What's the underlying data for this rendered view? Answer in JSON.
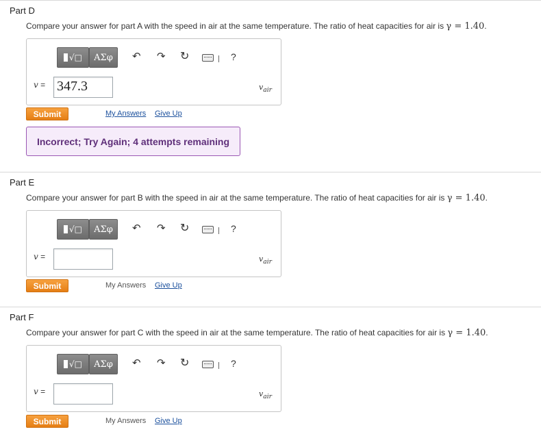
{
  "math": {
    "gamma_expr": "γ = 1.40",
    "variable": "v",
    "equals": "=",
    "unit": "v",
    "unit_sub": "air"
  },
  "toolbar": {
    "templates_glyph": "√□",
    "greek_label": "ΑΣφ",
    "undo_icon": "↶",
    "redo_icon": "↷",
    "reset_icon": "↻",
    "help_label": "?"
  },
  "parts": [
    {
      "title": "Part D",
      "question": "Compare your answer for part A with the speed in air at the same temperature. The ratio of heat capacities for air is ",
      "answer_value": "347.3",
      "submit_label": "Submit",
      "my_answers_label": "My Answers",
      "give_up_label": "Give Up",
      "feedback": "Incorrect; Try Again; 4 attempts remaining"
    },
    {
      "title": "Part E",
      "question": "Compare your answer for part B with the speed in air at the same temperature. The ratio of heat capacities for air is ",
      "answer_value": "",
      "submit_label": "Submit",
      "my_answers_label": "My Answers",
      "give_up_label": "Give Up"
    },
    {
      "title": "Part F",
      "question": "Compare your answer for part C with the speed in air at the same temperature. The ratio of heat capacities for air is ",
      "answer_value": "",
      "submit_label": "Submit",
      "my_answers_label": "My Answers",
      "give_up_label": "Give Up"
    }
  ]
}
